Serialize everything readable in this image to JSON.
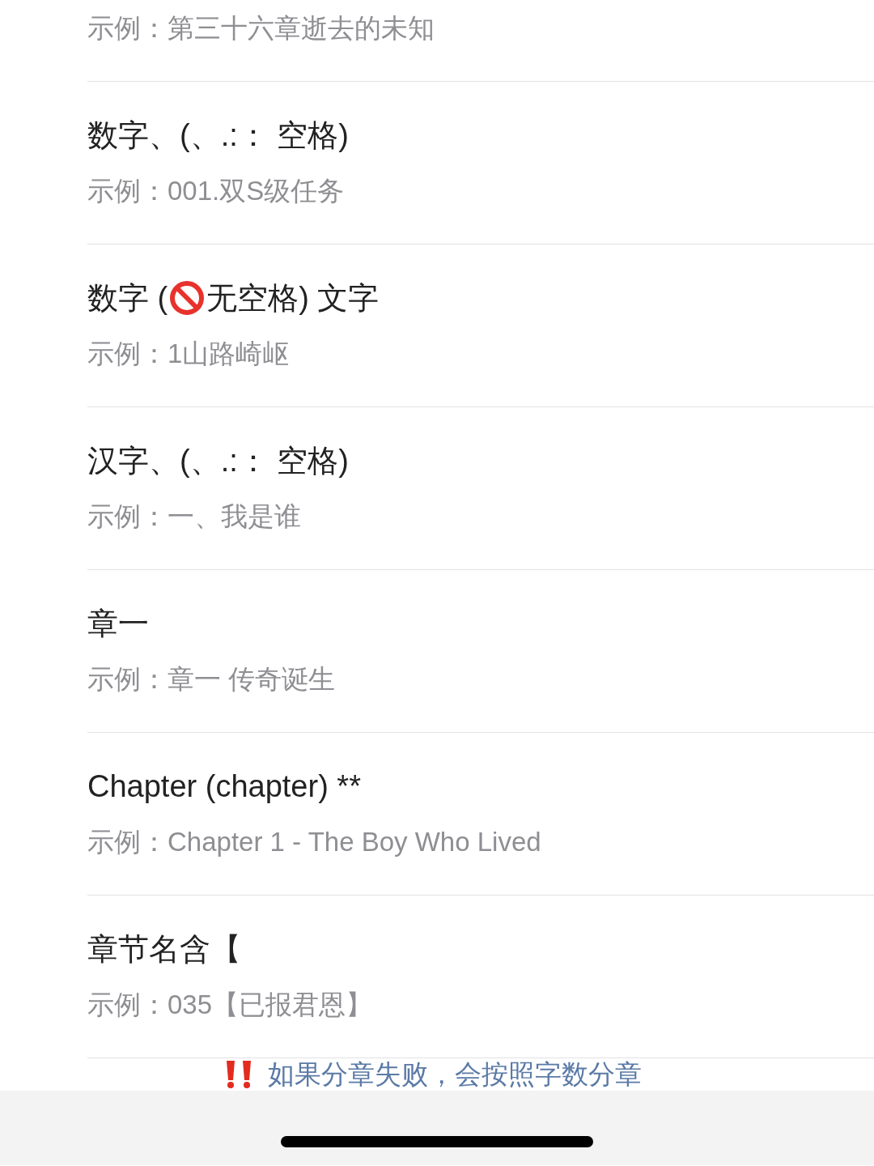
{
  "partial_item": {
    "example": "示例：第三十六章逝去的未知"
  },
  "items": [
    {
      "title": "数字、(、.:： 空格)",
      "example": "示例：001.双S级任务"
    },
    {
      "title": "数字 (",
      "title_rest": "无空格) 文字",
      "example": "示例：1山路崎岖"
    },
    {
      "title": "汉字、(、.:： 空格)",
      "example": "示例：一、我是谁"
    },
    {
      "title": "章一",
      "example": "示例：章一 传奇诞生"
    },
    {
      "title": "Chapter (chapter) **",
      "example": "示例：Chapter 1 - The Boy Who Lived"
    },
    {
      "title": "章节名含【",
      "example": "示例：035【已报君恩】"
    }
  ],
  "notice": {
    "text": "如果分章失败，会按照字数分章"
  }
}
